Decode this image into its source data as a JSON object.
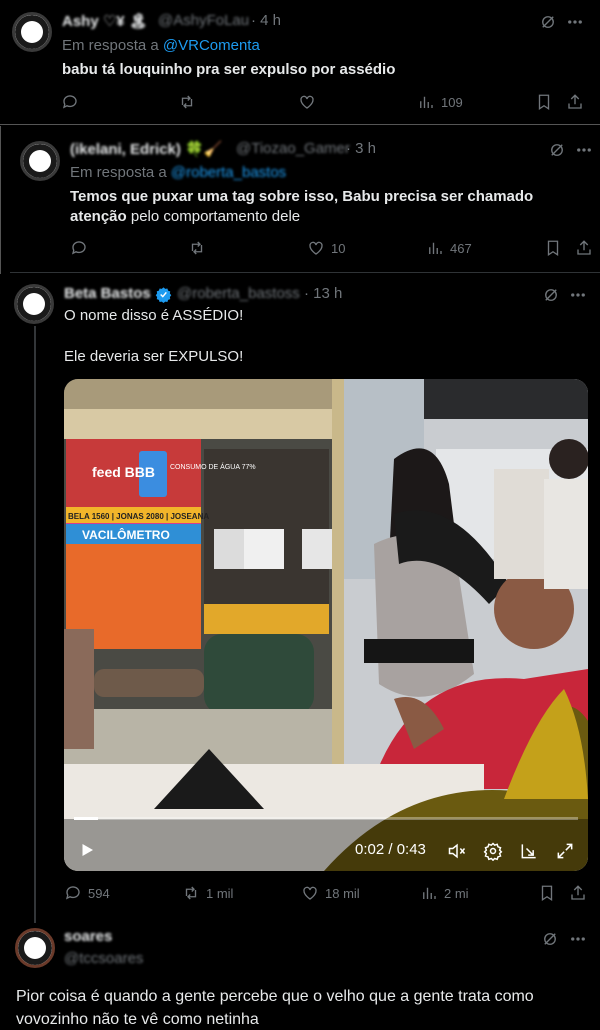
{
  "tweets": [
    {
      "name": "Ashy ♡¥ 🏝",
      "handle": "@AshyFoLau",
      "time": "· 4 h",
      "reply_prefix": "Em resposta a",
      "reply_to": "@VRComenta",
      "text": "babu tá louquinho pra ser expulso por assédio",
      "views": "109"
    },
    {
      "name": "(ikelani, Edrick) 🍀🧹",
      "handle": "@Tiozao_Gamer",
      "time": "· 3 h",
      "reply_prefix": "Em resposta a",
      "reply_to": "@roberta_bastos",
      "text_bold": "Temos que puxar uma tag sobre isso, Babu precisa ser chamado atenção",
      "text_rest": " pelo comportamento dele",
      "text_line1": "Temos que puxar uma tag sobre isso, Babu precisa ser chamado",
      "text_line2_bold": "atenção",
      "text_line2_rest": " pelo comportamento dele",
      "likes": "10",
      "views": "467"
    },
    {
      "name": "Beta Bastos",
      "handle": "@roberta_bastoss",
      "time": "· 13 h",
      "line1": "O nome disso é ASSÉDIO!",
      "line2": "Ele deveria ser EXPULSO!",
      "video_time": "0:02 / 0:43",
      "replies": "594",
      "retweets": "1 mil",
      "likes": "18 mil",
      "views": "2 mi",
      "video_board_title": "VACILÔMETRO",
      "video_board_feed": "feed BBB",
      "video_board_consumo": "CONSUMO DE ÁGUA 77%",
      "video_board_ticker": "BELA 1560 | JONAS 2080 | JOSEANA"
    },
    {
      "name": "soares",
      "handle": "@tccsoares",
      "text": "Pior coisa é quando a gente percebe que o velho que a gente trata como vovozinho não te vê como netinha"
    }
  ],
  "colors": {
    "background": "#000000",
    "text": "#e7e9ea",
    "muted": "#71767b",
    "link": "#1d9bf0",
    "divider": "#2f3336"
  },
  "icons": {
    "grok": "grok-icon",
    "more": "more-icon",
    "reply": "reply-icon",
    "retweet": "retweet-icon",
    "like": "like-icon",
    "views": "views-icon",
    "bookmark": "bookmark-icon",
    "share": "share-icon",
    "play": "play-icon",
    "mute": "mute-icon",
    "settings": "settings-icon",
    "pip": "pip-icon",
    "fullscreen": "fullscreen-icon"
  }
}
